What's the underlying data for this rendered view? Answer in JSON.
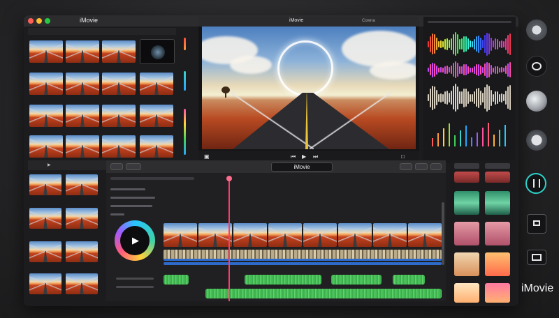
{
  "app": {
    "name": "iMovie",
    "logo_text": "iMovie"
  },
  "viewer": {
    "tab_title": "iMovie",
    "tab_right": "Cowna"
  },
  "timeline": {
    "title": "iMovie"
  },
  "colors": {
    "accent_playhead": "#ff3b6b",
    "audio_green": "#4cc45a",
    "audio_blue": "#2d6ac9",
    "window_bg": "#1c1c1e"
  },
  "icons": [
    "play-icon",
    "skip-back-icon",
    "skip-forward-icon",
    "traffic-light-close",
    "traffic-light-minimize",
    "traffic-light-maximize"
  ]
}
